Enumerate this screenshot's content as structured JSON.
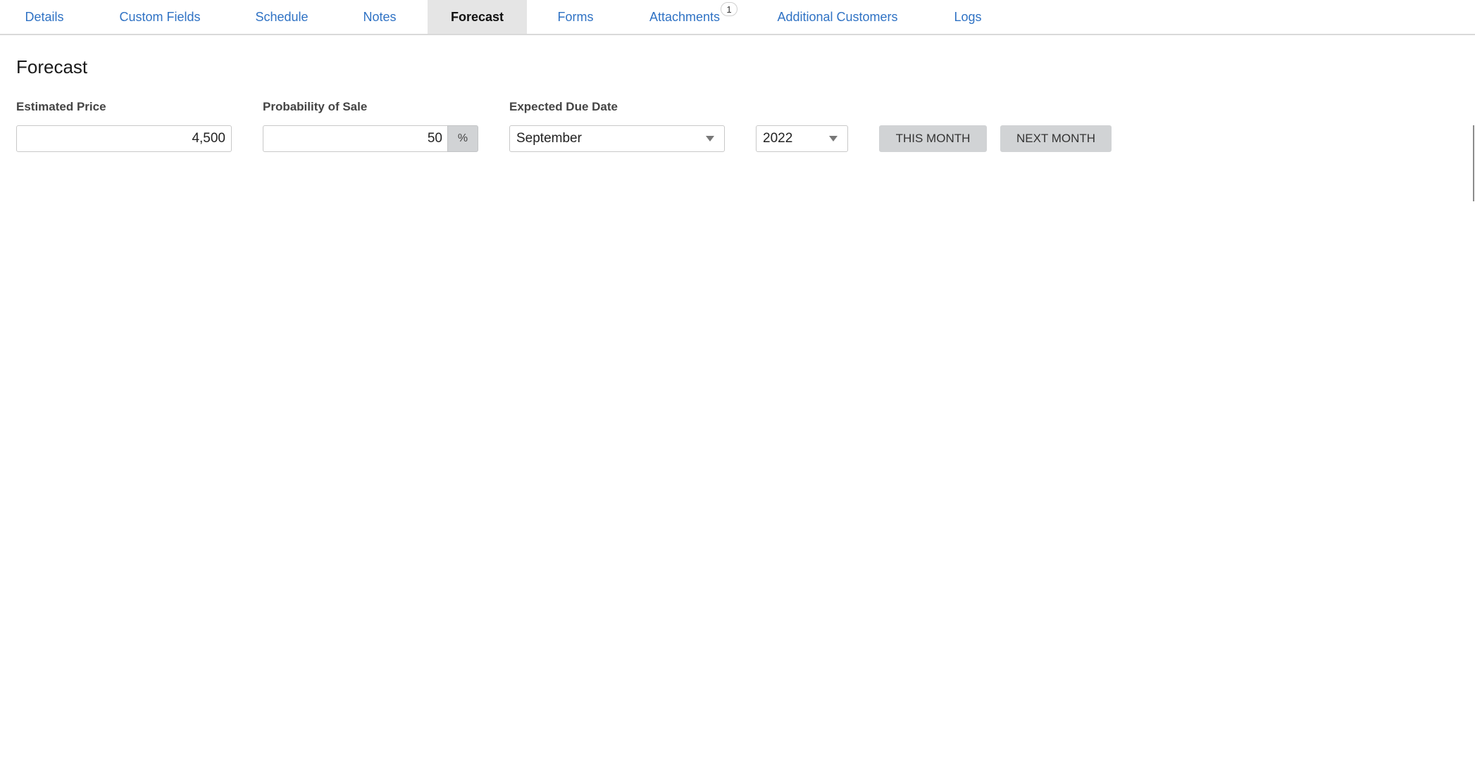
{
  "tabs": [
    {
      "label": "Details"
    },
    {
      "label": "Custom Fields"
    },
    {
      "label": "Schedule"
    },
    {
      "label": "Notes"
    },
    {
      "label": "Forecast"
    },
    {
      "label": "Forms"
    },
    {
      "label": "Attachments",
      "badge": "1"
    },
    {
      "label": "Additional Customers"
    },
    {
      "label": "Logs"
    }
  ],
  "active_tab": "Forecast",
  "page": {
    "title": "Forecast"
  },
  "form": {
    "estimated_price": {
      "label": "Estimated Price",
      "value": "4,500"
    },
    "probability": {
      "label": "Probability of Sale",
      "value": "50",
      "unit": "%"
    },
    "due_date": {
      "label": "Expected Due Date",
      "month": "September",
      "year": "2022"
    },
    "buttons": {
      "this_month": "THIS MONTH",
      "next_month": "NEXT MONTH"
    }
  },
  "colors": {
    "link": "#2f72c4",
    "active_tab_bg": "#e5e5e5",
    "button_bg": "#d1d3d5"
  }
}
